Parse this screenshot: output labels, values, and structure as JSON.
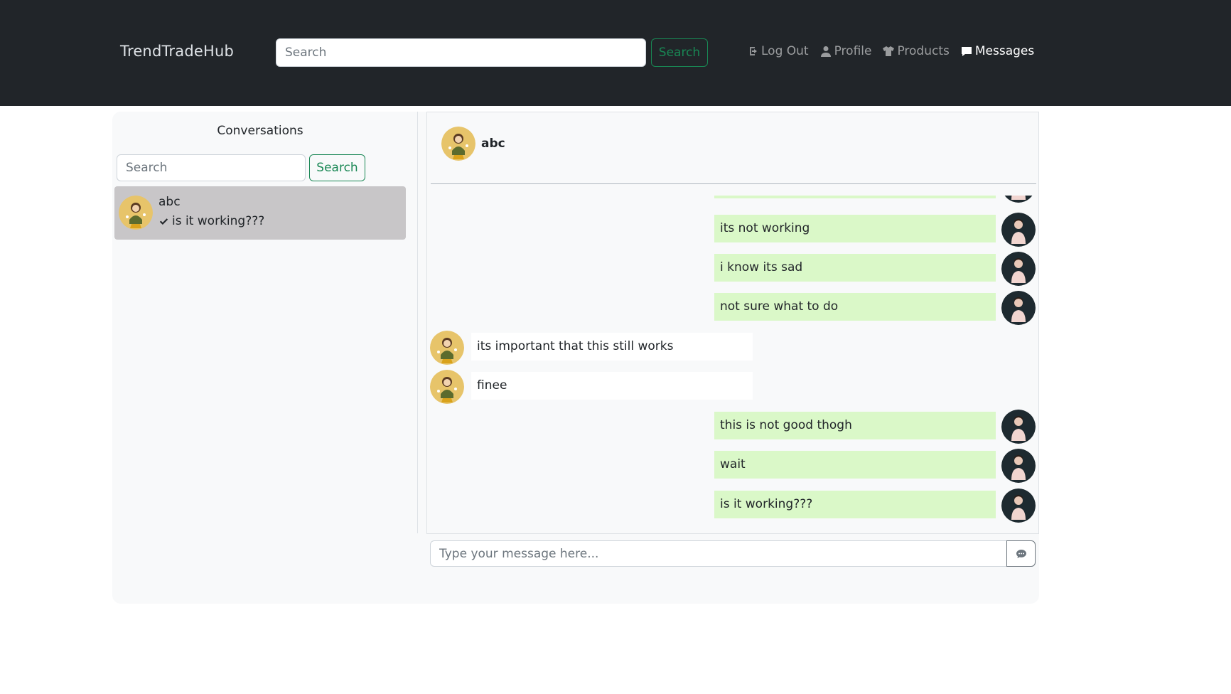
{
  "navbar": {
    "brand": "TrendTradeHub",
    "search_placeholder": "Search",
    "search_button": "Search",
    "links": [
      {
        "label": "Log Out",
        "icon": "logout-icon"
      },
      {
        "label": "Profile",
        "icon": "user-icon"
      },
      {
        "label": "Products",
        "icon": "tshirt-icon"
      },
      {
        "label": "Messages",
        "icon": "message-icon",
        "active": true
      }
    ]
  },
  "sidebar": {
    "title": "Conversations",
    "search_placeholder": "Search",
    "search_button": "Search",
    "conversations": [
      {
        "name": "abc",
        "last_message": "is it working???",
        "status_icon": "check-icon"
      }
    ]
  },
  "chat": {
    "contact_name": "abc",
    "messages": [
      {
        "from": "me",
        "text": "its not working"
      },
      {
        "from": "me",
        "text": "i know its sad"
      },
      {
        "from": "me",
        "text": "not sure what to do"
      },
      {
        "from": "them",
        "text": "its important that this still works"
      },
      {
        "from": "them",
        "text": "finee"
      },
      {
        "from": "me",
        "text": "this is not good thogh"
      },
      {
        "from": "me",
        "text": "wait"
      },
      {
        "from": "me",
        "text": "is it working???"
      }
    ],
    "composer_placeholder": "Type your message here..."
  },
  "colors": {
    "navbar_bg": "#212529",
    "accent_green": "#198754",
    "sent_bubble": "#daf8c8",
    "received_bubble": "#ffffff",
    "selected_conversation": "#c8c6c8"
  }
}
